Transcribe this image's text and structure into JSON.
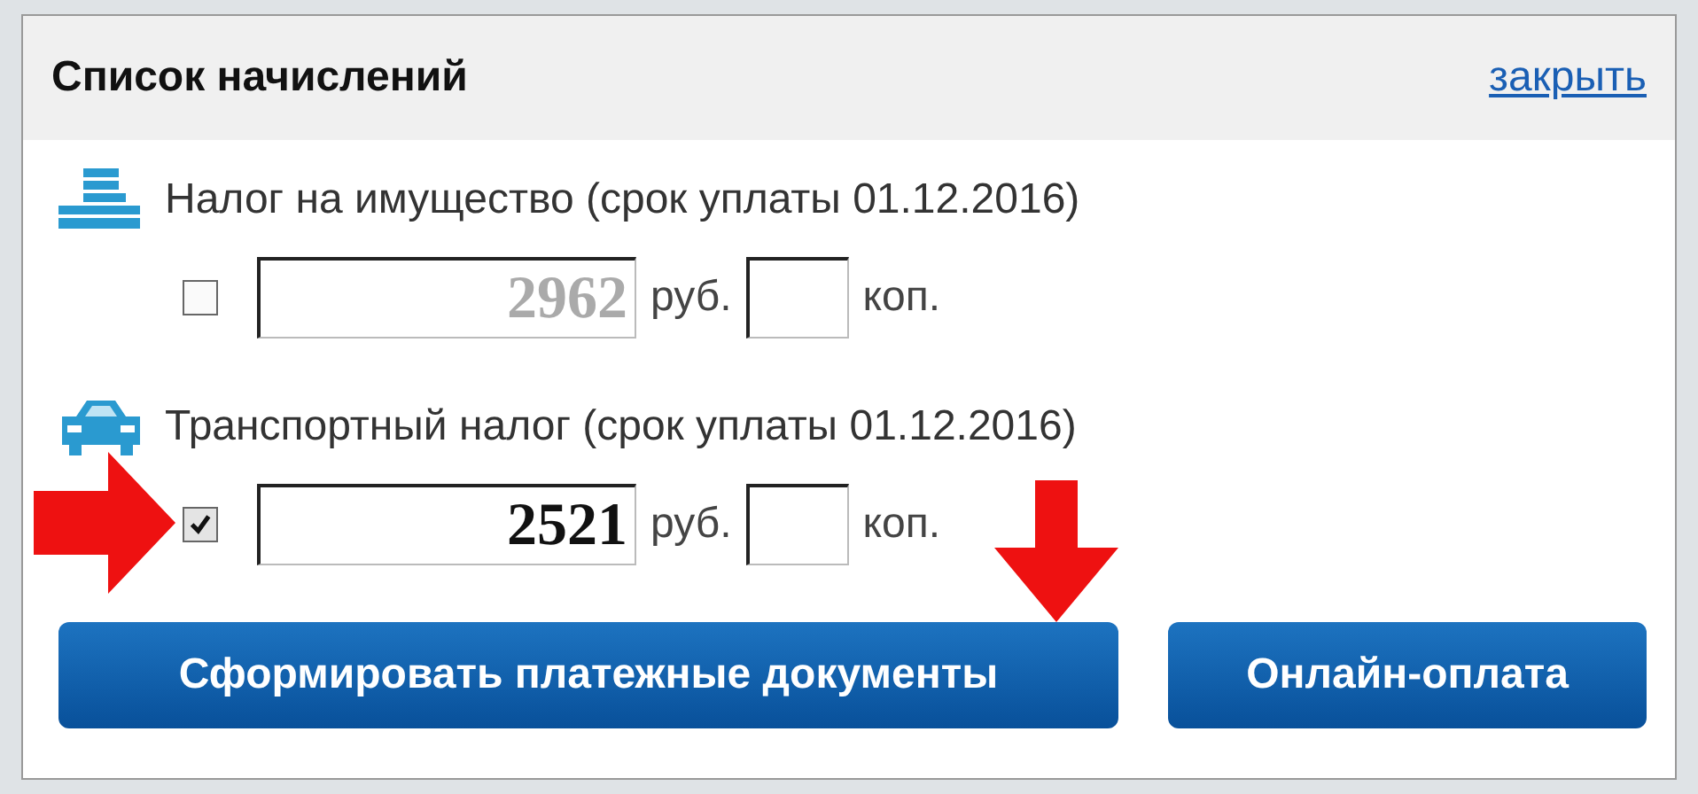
{
  "dialog": {
    "title": "Список начислений",
    "close_link": "закрыть"
  },
  "charges": [
    {
      "kind": "property",
      "title": "Налог на имущество (срок уплаты 01.12.2016)",
      "checked": false,
      "rubles": "2962",
      "rub_unit": "руб.",
      "kop_unit": "коп."
    },
    {
      "kind": "car",
      "title": "Транспортный налог (срок уплаты 01.12.2016)",
      "checked": true,
      "rubles": "2521",
      "rub_unit": "руб.",
      "kop_unit": "коп."
    }
  ],
  "buttons": [
    "Сформировать платежные документы",
    "Онлайн-оплата"
  ]
}
